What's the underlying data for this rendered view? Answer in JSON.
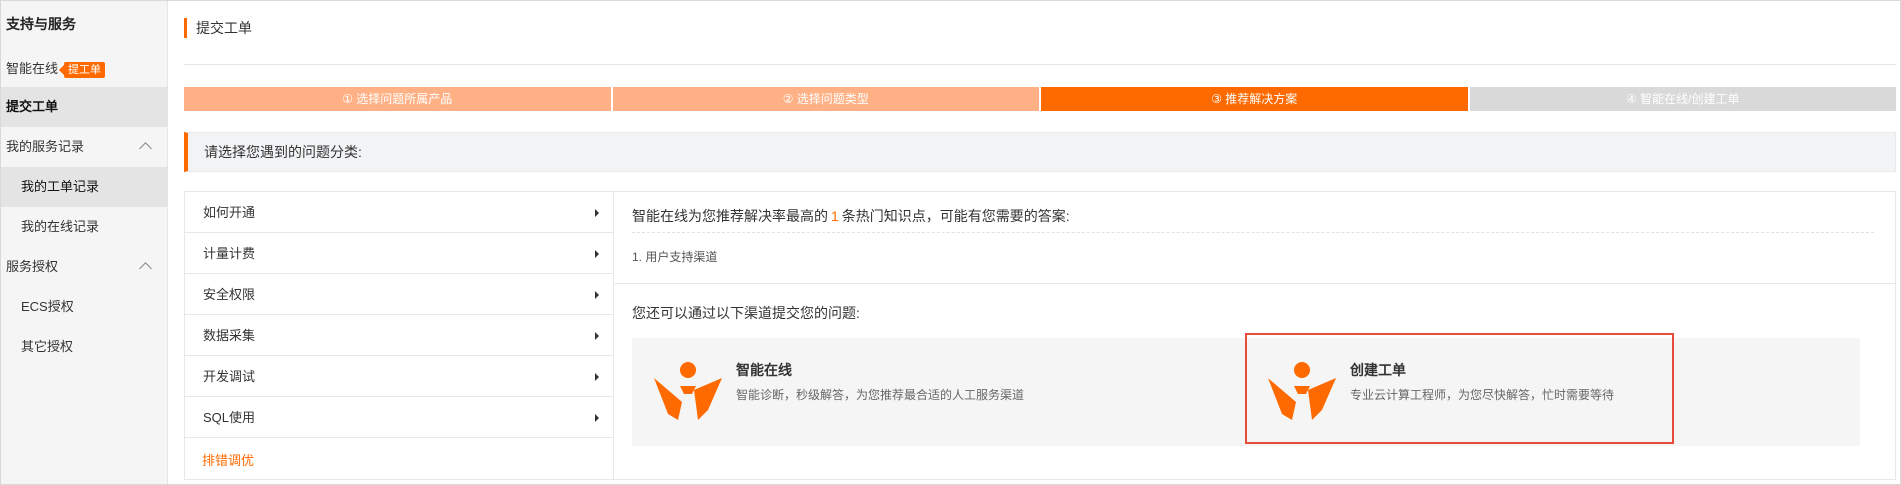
{
  "sidebar": {
    "title": "支持与服务",
    "items": [
      {
        "label": "智能在线",
        "badge": "提工单"
      },
      {
        "label": "提交工单"
      },
      {
        "label": "我的服务记录"
      },
      {
        "label": "我的工单记录"
      },
      {
        "label": "我的在线记录"
      },
      {
        "label": "服务授权"
      },
      {
        "label": "ECS授权"
      },
      {
        "label": "其它授权"
      }
    ]
  },
  "header": {
    "title": "提交工单"
  },
  "steps": [
    {
      "label": "① 选择问题所属产品",
      "state": "done"
    },
    {
      "label": "② 选择问题类型",
      "state": "done"
    },
    {
      "label": "③ 推荐解决方案",
      "state": "current"
    },
    {
      "label": "④ 智能在线/创建工单",
      "state": "todo"
    }
  ],
  "prompt": "请选择您遇到的问题分类:",
  "categories": [
    {
      "label": "如何开通"
    },
    {
      "label": "计量计费"
    },
    {
      "label": "安全权限"
    },
    {
      "label": "数据采集"
    },
    {
      "label": "开发调试"
    },
    {
      "label": "SQL使用"
    }
  ],
  "category_link": "排错调优",
  "recommend": {
    "prefix": "智能在线为您推荐解决率最高的",
    "count": "1",
    "suffix": "条热门知识点，可能有您需要的答案:",
    "items": [
      "1. 用户支持渠道"
    ]
  },
  "channels": {
    "label": "您还可以通过以下渠道提交您的问题:",
    "cards": [
      {
        "title": "智能在线",
        "desc": "智能诊断，秒级解答，为您推荐最合适的人工服务渠道",
        "icon": "service-person-icon"
      },
      {
        "title": "创建工单",
        "desc": "专业云计算工程师，为您尽快解答，忙时需要等待",
        "icon": "service-person-icon"
      }
    ]
  },
  "colors": {
    "accent": "#ff6a00",
    "step_done": "#ffb185",
    "step_todo": "#d9d9d9",
    "highlight": "#e84b3c"
  }
}
